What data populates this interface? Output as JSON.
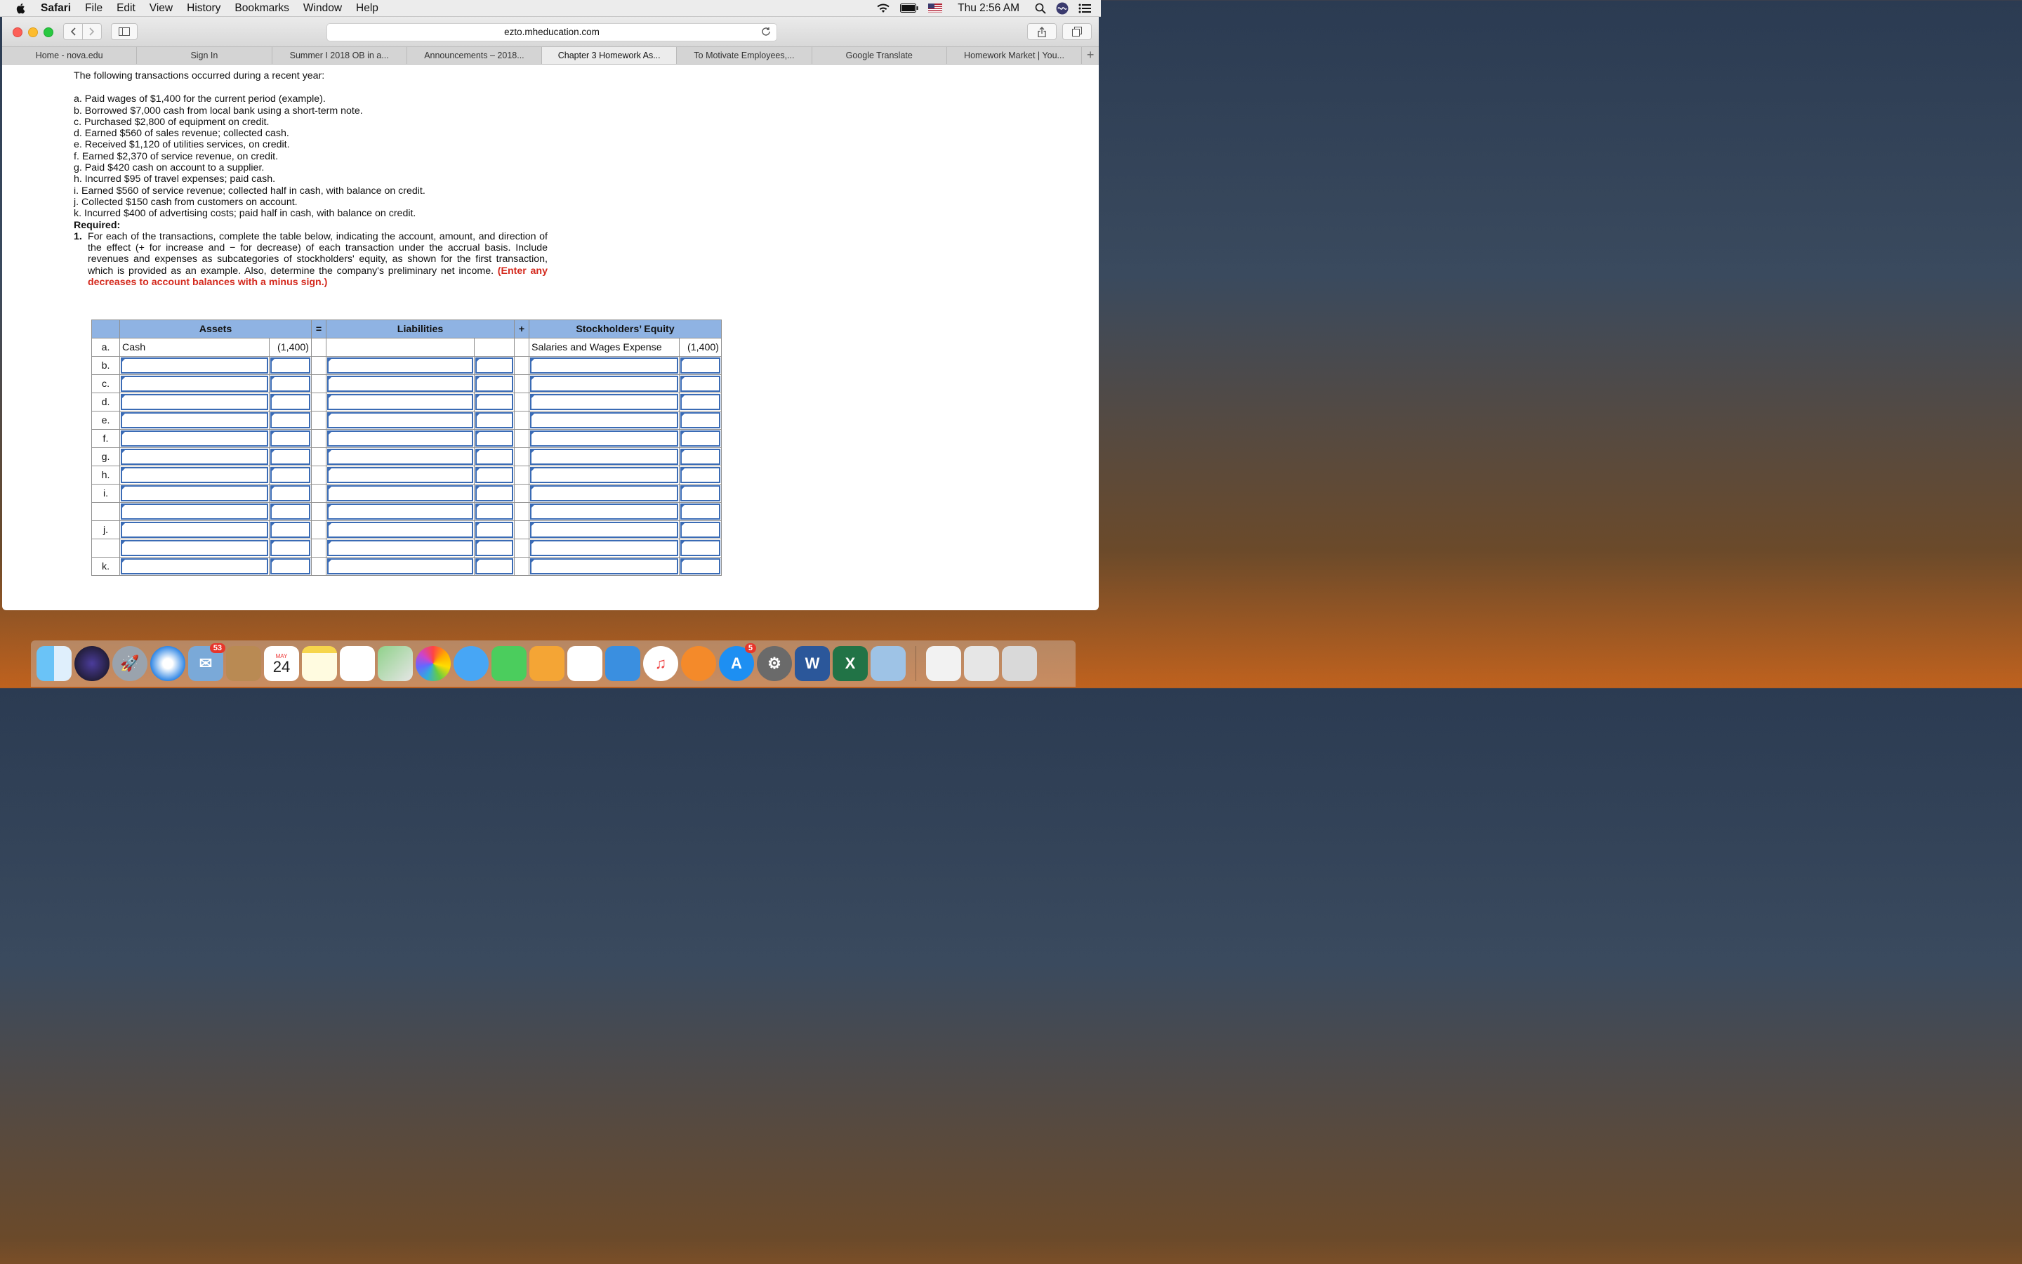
{
  "menubar": {
    "app": "Safari",
    "items": [
      "File",
      "Edit",
      "View",
      "History",
      "Bookmarks",
      "Window",
      "Help"
    ],
    "clock": "Thu 2:56 AM"
  },
  "browser": {
    "url": "ezto.mheducation.com",
    "tabs": [
      "Home - nova.edu",
      "Sign In",
      "Summer I 2018 OB in a...",
      "Announcements – 2018...",
      "Chapter 3 Homework As...",
      "To Motivate Employees,...",
      "Google Translate",
      "Homework Market | You..."
    ],
    "active_tab": 4
  },
  "problem": {
    "intro": "The following transactions occurred during a recent year:",
    "transactions": [
      "a. Paid wages of $1,400 for the current period (example).",
      "b. Borrowed $7,000 cash from local bank using a short-term note.",
      "c. Purchased $2,800 of equipment on credit.",
      "d. Earned $560 of sales revenue; collected cash.",
      "e. Received $1,120 of utilities services, on credit.",
      "f. Earned $2,370 of service revenue, on credit.",
      "g. Paid $420 cash on account to a supplier.",
      "h. Incurred $95 of travel expenses; paid cash.",
      "i. Earned $560 of service revenue; collected half in cash, with balance on credit.",
      "j. Collected $150 cash from customers on account.",
      "k. Incurred $400 of advertising costs; paid half in cash, with balance on credit."
    ],
    "required_label": "Required:",
    "req_num": "1.",
    "req_text": "For each of the transactions, complete the table below, indicating the account, amount, and direction of the effect (+ for increase and − for decrease) of each transaction under the accrual basis. Include revenues and expenses as subcategories of stockholders' equity, as shown for the first transaction, which is provided as an example. Also, determine the company's preliminary net income.",
    "req_red": "(Enter any decreases to account balances with a minus sign.)"
  },
  "table": {
    "headers": {
      "assets": "Assets",
      "eq": "=",
      "liabilities": "Liabilities",
      "plus": "+",
      "equity": "Stockholders’ Equity"
    },
    "example": {
      "label": "a.",
      "asset_account": "Cash",
      "asset_amount": "(1,400)",
      "equity_account": "Salaries and Wages Expense",
      "equity_amount": "(1,400)"
    },
    "row_labels": [
      "b.",
      "c.",
      "d.",
      "e.",
      "f.",
      "g.",
      "h.",
      "i.",
      "",
      "j.",
      "",
      "k."
    ]
  },
  "dock": {
    "mail_badge": "53",
    "calendar_month": "MAY",
    "calendar_day": "24",
    "appstore_badge": "5"
  }
}
